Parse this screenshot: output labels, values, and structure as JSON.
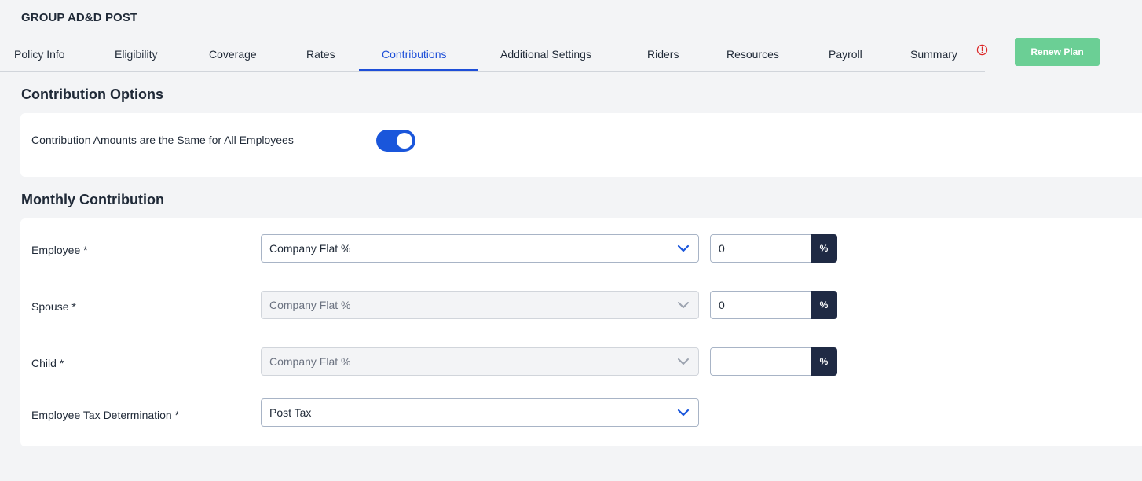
{
  "header": {
    "plan_title": "GROUP AD&D POST",
    "renew_label": "Renew Plan",
    "renew_color": "#6bcf95",
    "alert_icon": "exclamation-circle-icon"
  },
  "tabs": [
    {
      "label": "Policy Info",
      "active": false
    },
    {
      "label": "Eligibility",
      "active": false
    },
    {
      "label": "Coverage",
      "active": false
    },
    {
      "label": "Rates",
      "active": false
    },
    {
      "label": "Contributions",
      "active": true
    },
    {
      "label": "Additional Settings",
      "active": false
    },
    {
      "label": "Riders",
      "active": false
    },
    {
      "label": "Resources",
      "active": false
    },
    {
      "label": "Payroll",
      "active": false
    },
    {
      "label": "Summary",
      "active": false
    }
  ],
  "contribution_options": {
    "title": "Contribution Options",
    "same_for_all_label": "Contribution Amounts are the Same for All Employees",
    "same_for_all_on": true,
    "toggle_color": "#1a56db"
  },
  "monthly_contribution": {
    "title": "Monthly Contribution",
    "rows": [
      {
        "label": "Employee *",
        "select_value": "Company Flat %",
        "disabled": false,
        "amount": "0",
        "unit": "%"
      },
      {
        "label": "Spouse *",
        "select_value": "Company Flat %",
        "disabled": true,
        "amount": "0",
        "unit": "%"
      },
      {
        "label": "Child *",
        "select_value": "Company Flat %",
        "disabled": true,
        "amount": "",
        "unit": "%"
      }
    ],
    "tax": {
      "label": "Employee Tax Determination *",
      "select_value": "Post Tax"
    }
  }
}
